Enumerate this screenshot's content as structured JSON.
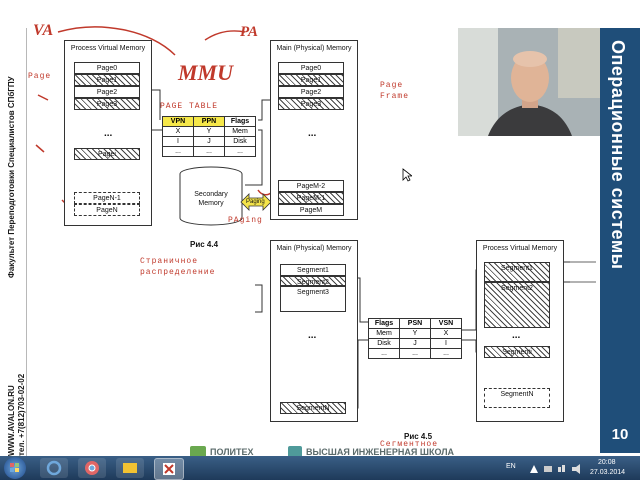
{
  "left_strip": {
    "faculty": "Факультет Переподготовки Специалистов СПбГПУ",
    "website": "WWW.AVALON.RU",
    "phone": "тел. +7(812)703-02-02"
  },
  "right_panel": {
    "title": "Операционные системы",
    "slide_number": "10"
  },
  "fig44": {
    "caption": "Рис 4.4",
    "pvm_title": "Process Virtual Memory",
    "pvm_pages": [
      "Page0",
      "Page1",
      "Page2",
      "Page3",
      "...",
      "Pagei",
      "PageN-1",
      "PageN"
    ],
    "main_title": "Main (Physical) Memory",
    "main_pages": [
      "Page0",
      "Page1",
      "Page2",
      "Page3",
      "...",
      "PageM-2",
      "PageM-1",
      "PageM"
    ],
    "page_table_label": "PAGE TABLE",
    "pt_headers": [
      "VPN",
      "PPN",
      "Flags"
    ],
    "pt_rows": [
      [
        "X",
        "Y",
        "Mem"
      ],
      [
        "I",
        "J",
        "Disk"
      ],
      [
        "...",
        "...",
        "..."
      ]
    ],
    "secondary": "Secondary Memory",
    "paging": "PAging",
    "paging_small": "Paging",
    "page_left": "Page",
    "page_frame": "Page Frame"
  },
  "fig45": {
    "caption": "Рис 4.5",
    "main_title": "Main (Physical) Memory",
    "main_segments": [
      "Segment1",
      "Segment2",
      "Segment3",
      "...",
      "SegmentN"
    ],
    "pvm_title": "Process Virtual Memory",
    "pvm_segments": [
      "Segment1",
      "Segment2",
      "...",
      "Segmenti",
      "SegmentN"
    ],
    "st_headers": [
      "Flags",
      "PSN",
      "VSN"
    ],
    "st_rows": [
      [
        "Mem",
        "Y",
        "X"
      ],
      [
        "Disk",
        "J",
        "I"
      ],
      [
        "...",
        "...",
        "..."
      ]
    ],
    "annotation": "Страничное распределение",
    "bottom_annotation": "Сегментное"
  },
  "handwriting": {
    "va": "VA",
    "pa": "PA",
    "mmu": "MMU"
  },
  "logos": {
    "politeh": "ПОЛИТЕХ",
    "school": "ВЫСШАЯ ИНЖЕНЕРНАЯ ШКОЛА"
  },
  "taskbar": {
    "lang": "EN",
    "time": "20:08",
    "date": "27.03.2014"
  }
}
